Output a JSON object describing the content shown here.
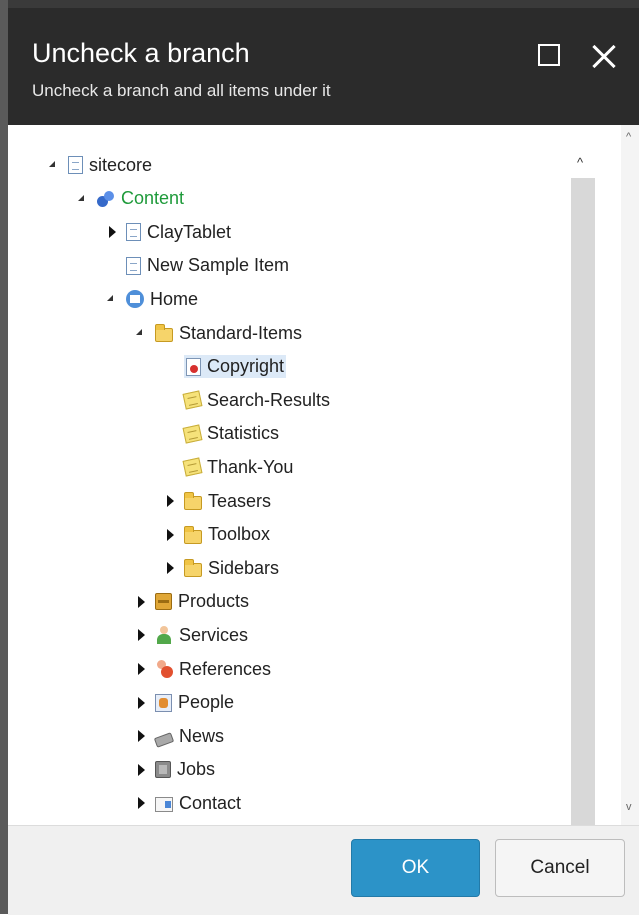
{
  "dialog": {
    "title": "Uncheck a branch",
    "subtitle": "Uncheck a branch and all items under it",
    "maximize_icon": "maximize-icon",
    "close_icon": "close-icon"
  },
  "tree": {
    "nodes": [
      {
        "label": "sitecore",
        "icon": "document-icon",
        "state": "expanded",
        "depth": 0
      },
      {
        "label": "Content",
        "icon": "content-icon",
        "state": "expanded",
        "depth": 1,
        "color": "#1e9a3a"
      },
      {
        "label": "ClayTablet",
        "icon": "document-icon",
        "state": "collapsed",
        "depth": 2
      },
      {
        "label": "New Sample Item",
        "icon": "document-icon",
        "state": "none",
        "depth": 2
      },
      {
        "label": "Home",
        "icon": "home-icon",
        "state": "expanded",
        "depth": 2
      },
      {
        "label": "Standard-Items",
        "icon": "folder-icon",
        "state": "expanded",
        "depth": 3
      },
      {
        "label": "Copyright",
        "icon": "certificate-icon",
        "state": "none",
        "depth": 4,
        "selected": true
      },
      {
        "label": "Search-Results",
        "icon": "note-icon",
        "state": "none",
        "depth": 4
      },
      {
        "label": "Statistics",
        "icon": "note-icon",
        "state": "none",
        "depth": 4
      },
      {
        "label": "Thank-You",
        "icon": "note-icon",
        "state": "none",
        "depth": 4
      },
      {
        "label": "Teasers",
        "icon": "folder-icon",
        "state": "collapsed",
        "depth": 4
      },
      {
        "label": "Toolbox",
        "icon": "folder-icon",
        "state": "collapsed",
        "depth": 4
      },
      {
        "label": "Sidebars",
        "icon": "folder-icon",
        "state": "collapsed",
        "depth": 4
      },
      {
        "label": "Products",
        "icon": "box-icon",
        "state": "collapsed",
        "depth": 3
      },
      {
        "label": "Services",
        "icon": "person-icon",
        "state": "collapsed",
        "depth": 3
      },
      {
        "label": "References",
        "icon": "references-icon",
        "state": "collapsed",
        "depth": 3
      },
      {
        "label": "People",
        "icon": "people-icon",
        "state": "collapsed",
        "depth": 3
      },
      {
        "label": "News",
        "icon": "news-icon",
        "state": "collapsed",
        "depth": 3
      },
      {
        "label": "Jobs",
        "icon": "jobs-icon",
        "state": "collapsed",
        "depth": 3
      },
      {
        "label": "Contact",
        "icon": "contact-icon",
        "state": "collapsed",
        "depth": 3
      }
    ]
  },
  "footer": {
    "ok_label": "OK",
    "cancel_label": "Cancel"
  },
  "colors": {
    "header_bg": "#2b2b2b",
    "ok_bg": "#2c93c8",
    "selected_bg": "#dce9f7",
    "content_label": "#1e9a3a"
  }
}
